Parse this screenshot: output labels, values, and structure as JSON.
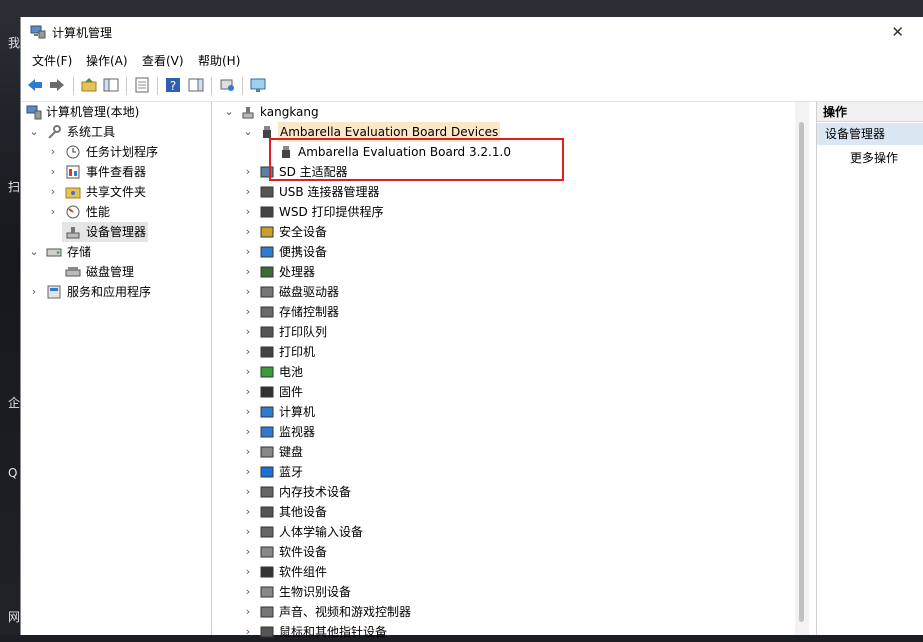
{
  "window": {
    "title": "计算机管理",
    "close_glyph": "✕"
  },
  "menu": [
    "文件(F)",
    "操作(A)",
    "查看(V)",
    "帮助(H)"
  ],
  "left_tree": {
    "root": "计算机管理(本地)",
    "system_tools": "系统工具",
    "task_scheduler": "任务计划程序",
    "event_viewer": "事件查看器",
    "shared_folders": "共享文件夹",
    "performance": "性能",
    "device_manager": "设备管理器",
    "storage": "存储",
    "disk_management": "磁盘管理",
    "services_apps": "服务和应用程序"
  },
  "device_tree": {
    "computer": "kangkang",
    "ambarella_group": "Ambarella Evaluation Board Devices",
    "ambarella_device": "Ambarella Evaluation Board 3.2.1.0",
    "categories": [
      "SD 主适配器",
      "USB 连接器管理器",
      "WSD 打印提供程序",
      "安全设备",
      "便携设备",
      "处理器",
      "磁盘驱动器",
      "存储控制器",
      "打印队列",
      "打印机",
      "电池",
      "固件",
      "计算机",
      "监视器",
      "键盘",
      "蓝牙",
      "内存技术设备",
      "其他设备",
      "人体学输入设备",
      "软件设备",
      "软件组件",
      "生物识别设备",
      "声音、视频和游戏控制器",
      "鼠标和其他指针设备"
    ]
  },
  "actions": {
    "header": "操作",
    "section": "设备管理器",
    "more": "更多操作"
  },
  "desktop_glyphs": [
    "我",
    "扫",
    "企",
    "Q",
    "网"
  ],
  "colors": {
    "selection": "#dbe8f4",
    "highlight_box": "#e02020",
    "row_highlight": "#fde7c9"
  }
}
